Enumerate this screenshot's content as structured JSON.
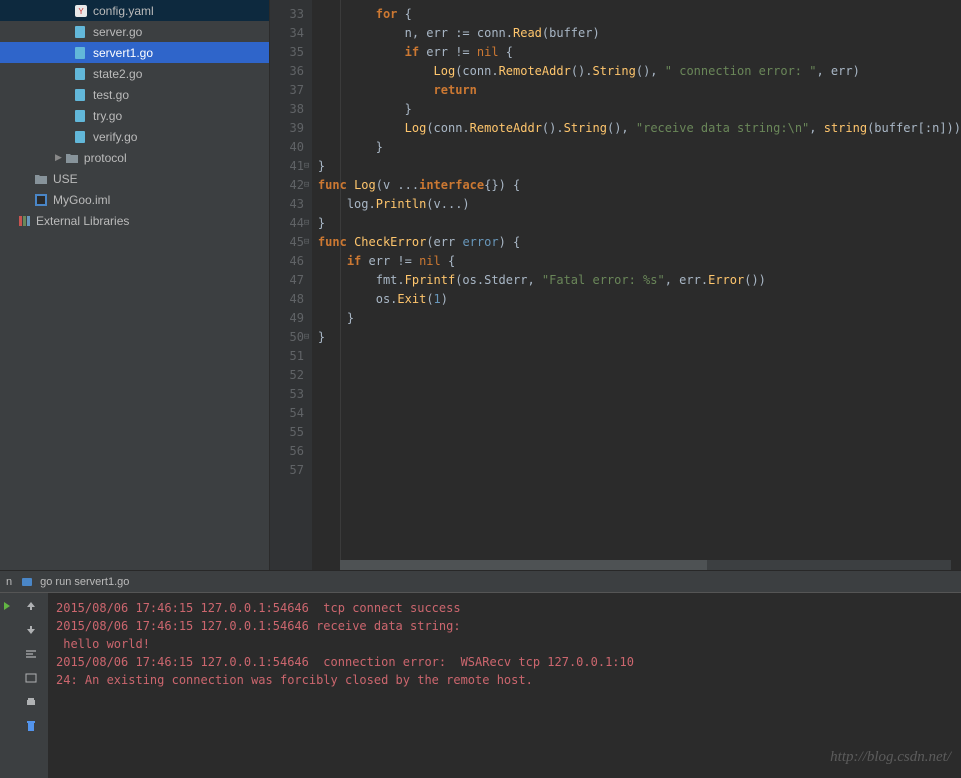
{
  "sidebar": {
    "items": [
      {
        "label": "config.yaml",
        "indent": 65,
        "icon": "yaml",
        "sel": false
      },
      {
        "label": "server.go",
        "indent": 65,
        "icon": "go",
        "sel": false
      },
      {
        "label": "servert1.go",
        "indent": 65,
        "icon": "go",
        "sel": true
      },
      {
        "label": "state2.go",
        "indent": 65,
        "icon": "go",
        "sel": false
      },
      {
        "label": "test.go",
        "indent": 65,
        "icon": "go",
        "sel": false
      },
      {
        "label": "try.go",
        "indent": 65,
        "icon": "go",
        "sel": false
      },
      {
        "label": "verify.go",
        "indent": 65,
        "icon": "go",
        "sel": false
      },
      {
        "label": "protocol",
        "indent": 47,
        "icon": "folder-closed",
        "arrow": true,
        "sel": false
      },
      {
        "label": "USE",
        "indent": 25,
        "icon": "folder",
        "sel": false
      },
      {
        "label": "MyGoo.iml",
        "indent": 25,
        "icon": "iml",
        "sel": false
      },
      {
        "label": "External Libraries",
        "indent": 8,
        "icon": "lib",
        "sel": false
      }
    ]
  },
  "gutter": {
    "start": 33,
    "end": 57
  },
  "code_lines": [
    {
      "n": 33,
      "html": "        <span class='kw'>for</span> {"
    },
    {
      "n": 34,
      "html": ""
    },
    {
      "n": 35,
      "html": "            n, err := conn.<span class='fn'>Read</span>(buffer)"
    },
    {
      "n": 36,
      "html": ""
    },
    {
      "n": 37,
      "html": "            <span class='kw'>if</span> err != <span class='kw2'>nil</span> {"
    },
    {
      "n": 38,
      "html": "                <span class='fn'>Log</span>(conn.<span class='fn'>RemoteAddr</span>().<span class='fn'>String</span>(), <span class='str'>\" connection error: \"</span>, err)"
    },
    {
      "n": 39,
      "html": "                <span class='kw'>return</span>"
    },
    {
      "n": 40,
      "html": "            }"
    },
    {
      "n": 41,
      "html": ""
    },
    {
      "n": 42,
      "html": ""
    },
    {
      "n": 43,
      "html": "            <span class='fn'>Log</span>(conn.<span class='fn'>RemoteAddr</span>().<span class='fn'>String</span>(), <span class='str'>\"receive data string:\\n\"</span>, <span class='fn'>string</span>(buffer[:n]))"
    },
    {
      "n": 44,
      "html": ""
    },
    {
      "n": 45,
      "html": "        }"
    },
    {
      "n": 46,
      "html": ""
    },
    {
      "n": 47,
      "html": "}",
      "fold": "-"
    },
    {
      "n": 48,
      "html": "<span class='kw'>func</span> <span class='fn'>Log</span>(v ...<span class='kw'>interface</span>{}) {",
      "fold": "-"
    },
    {
      "n": 49,
      "html": "    log.<span class='fn'>Println</span>(v...)"
    },
    {
      "n": 50,
      "html": "}",
      "fold": "-"
    },
    {
      "n": 51,
      "html": ""
    },
    {
      "n": 52,
      "html": "<span class='kw'>func</span> <span class='fn'>CheckError</span>(err <span class='type'>error</span>) {",
      "fold": "-"
    },
    {
      "n": 53,
      "html": "    <span class='kw'>if</span> err != <span class='kw2'>nil</span> {"
    },
    {
      "n": 54,
      "html": "        fmt.<span class='fn'>Fprintf</span>(os.Stderr, <span class='str'>\"Fatal error: %s\"</span>, err.<span class='fn'>Error</span>())"
    },
    {
      "n": 55,
      "html": "        os.<span class='fn'>Exit</span>(<span class='num'>1</span>)"
    },
    {
      "n": 56,
      "html": "    }"
    },
    {
      "n": 57,
      "html": "}",
      "fold": "-"
    }
  ],
  "terminal": {
    "prefix": "n",
    "command": "go run servert1.go",
    "lines": [
      {
        "cls": "log-red",
        "text": "2015/08/06 17:46:15 127.0.0.1:54646  tcp connect success"
      },
      {
        "cls": "log-red",
        "text": "2015/08/06 17:46:15 127.0.0.1:54646 receive data string:"
      },
      {
        "cls": "log-red",
        "text": " hello world!"
      },
      {
        "cls": "log-red",
        "text": "2015/08/06 17:46:15 127.0.0.1:54646  connection error:  WSARecv tcp 127.0.0.1:10"
      },
      {
        "cls": "log-red",
        "text": "24: An existing connection was forcibly closed by the remote host."
      }
    ]
  },
  "watermark": "http://blog.csdn.net/",
  "icons": {
    "go": "go-file-icon",
    "yaml": "yaml-file-icon",
    "folder": "folder-icon",
    "folder-closed": "folder-closed-icon",
    "iml": "iml-file-icon",
    "lib": "library-icon"
  }
}
